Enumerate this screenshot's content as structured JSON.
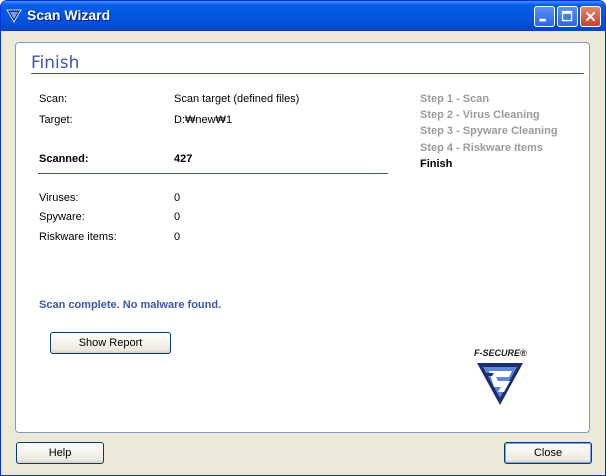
{
  "window": {
    "title": "Scan Wizard"
  },
  "panel": {
    "title": "Finish",
    "rows": [
      {
        "label": "Scan:",
        "value": "Scan target (defined files)"
      },
      {
        "label": "Target:",
        "value": "D:₩new₩1"
      }
    ],
    "scanned": {
      "label": "Scanned:",
      "value": "427"
    },
    "counts": [
      {
        "label": "Viruses:",
        "value": "0"
      },
      {
        "label": "Spyware:",
        "value": "0"
      },
      {
        "label": "Riskware items:",
        "value": "0"
      }
    ],
    "status": "Scan complete. No malware found.",
    "show_report_label": "Show Report",
    "steps": [
      {
        "label": "Step 1 - Scan",
        "current": false
      },
      {
        "label": "Step 2 - Virus Cleaning",
        "current": false
      },
      {
        "label": "Step 3 - Spyware Cleaning",
        "current": false
      },
      {
        "label": "Step 4 - Riskware Items",
        "current": false
      },
      {
        "label": "Finish",
        "current": true
      }
    ],
    "logo_text": "F-SECURE®"
  },
  "footer": {
    "help_label": "Help",
    "close_label": "Close"
  },
  "colors": {
    "accent": "#3e55b0",
    "titlebar": "#0058e6",
    "step_inactive": "#9a9a9a"
  }
}
